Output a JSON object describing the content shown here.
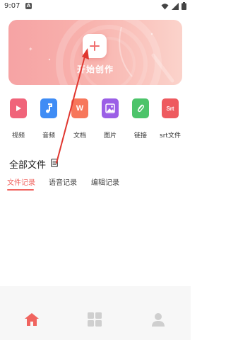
{
  "status_bar": {
    "time": "9:07",
    "notification_badge": "A",
    "icons": [
      "wifi-icon",
      "signal-icon",
      "battery-icon"
    ]
  },
  "hero": {
    "label": "开始创作",
    "button_icon": "plus-icon"
  },
  "actions": [
    {
      "key": "video",
      "label": "视频",
      "icon": "video-icon",
      "color": "#f0647a"
    },
    {
      "key": "audio",
      "label": "音频",
      "icon": "music-note-icon",
      "color": "#3f8cf5"
    },
    {
      "key": "document",
      "label": "文档",
      "icon": "word-doc-icon",
      "color": "#f7775b",
      "glyph": "W"
    },
    {
      "key": "image",
      "label": "图片",
      "icon": "image-icon",
      "color": "#9b5fe6"
    },
    {
      "key": "link",
      "label": "链接",
      "icon": "paperclip-icon",
      "color": "#4cc46a"
    },
    {
      "key": "srt",
      "label": "srt文件",
      "icon": "srt-file-icon",
      "color": "#ee5a5f",
      "glyph": "Srt"
    }
  ],
  "section": {
    "title": "全部文件"
  },
  "tabs": [
    {
      "label": "文件记录",
      "active": true
    },
    {
      "label": "语音记录",
      "active": false
    },
    {
      "label": "编辑记录",
      "active": false
    }
  ],
  "bottom_nav": {
    "items": [
      {
        "icon": "home-icon",
        "active": true,
        "color": "#f0645f"
      },
      {
        "icon": "grid-icon",
        "active": false,
        "color": "#cfcfcf"
      },
      {
        "icon": "user-icon",
        "active": false,
        "color": "#cfcfcf"
      }
    ]
  },
  "colors": {
    "accent": "#f0645f",
    "hero_gradient_start": "#f6a3a4",
    "hero_gradient_end": "#fbd3cb",
    "annotation_arrow": "#e0362f"
  }
}
